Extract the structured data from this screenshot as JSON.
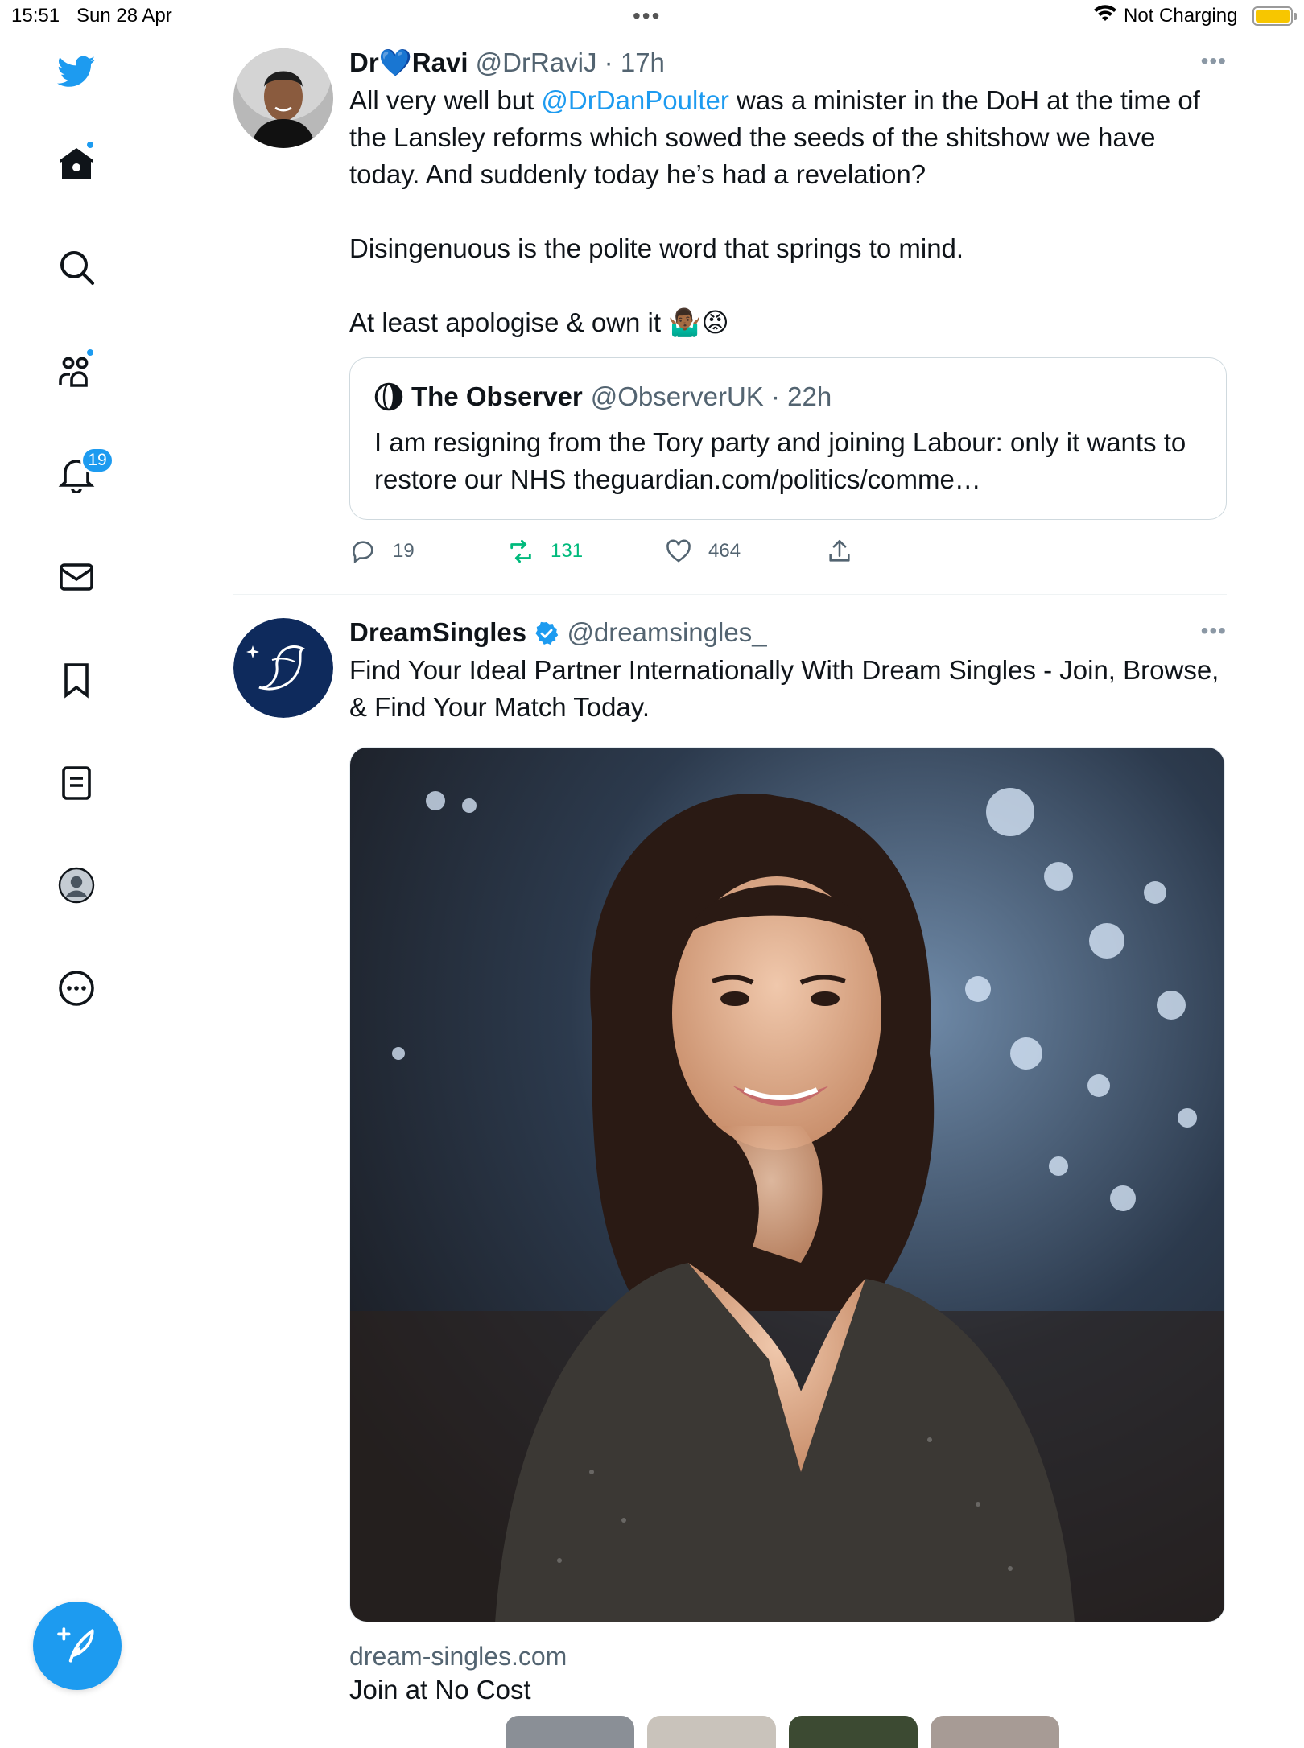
{
  "status_bar": {
    "time": "15:51",
    "date": "Sun 28 Apr",
    "charging": "Not Charging",
    "battery_level": 0.95
  },
  "sidebar": {
    "notifications_badge": "19",
    "items": [
      {
        "icon": "home-icon"
      },
      {
        "icon": "search-icon"
      },
      {
        "icon": "communities-icon"
      },
      {
        "icon": "notifications-icon"
      },
      {
        "icon": "messages-icon"
      },
      {
        "icon": "bookmarks-icon"
      },
      {
        "icon": "lists-icon"
      },
      {
        "icon": "profile-icon"
      },
      {
        "icon": "more-icon"
      }
    ],
    "compose_icon": "compose-icon"
  },
  "tweets": [
    {
      "name_prefix": "Dr",
      "name_emoji": "💙",
      "name_suffix": "Ravi",
      "handle": "@DrRaviJ",
      "time": "17h",
      "text_line1_pre": "All very well but ",
      "mention": "@DrDanPoulter",
      "text_line1_post": " was a minister in the DoH at the time of the Lansley reforms which sowed the seeds of the shitshow we have today. And suddenly today he’s had a revelation?",
      "text_para2": "Disingenuous is the polite word that springs to mind.",
      "text_para3": "At least apologise & own it 🤷🏾‍♂️😡",
      "quote": {
        "name": "The Observer",
        "handle": "@ObserverUK",
        "time": "22h",
        "text": "I am resigning from the Tory party and joining Labour: only it wants to restore our NHS theguardian.com/politics/comme…"
      },
      "replies": "19",
      "retweets": "131",
      "likes": "464"
    },
    {
      "name": "DreamSingles",
      "handle": "@dreamsingles_",
      "text": "Find Your Ideal Partner Internationally With Dream Singles - Join, Browse, & Find Your Match Today.",
      "domain": "dream-singles.com",
      "cta": "Join at No Cost"
    }
  ],
  "colors": {
    "accent": "#1d9bf0",
    "retweet": "#00ba7c",
    "secondary_text": "#536471"
  }
}
